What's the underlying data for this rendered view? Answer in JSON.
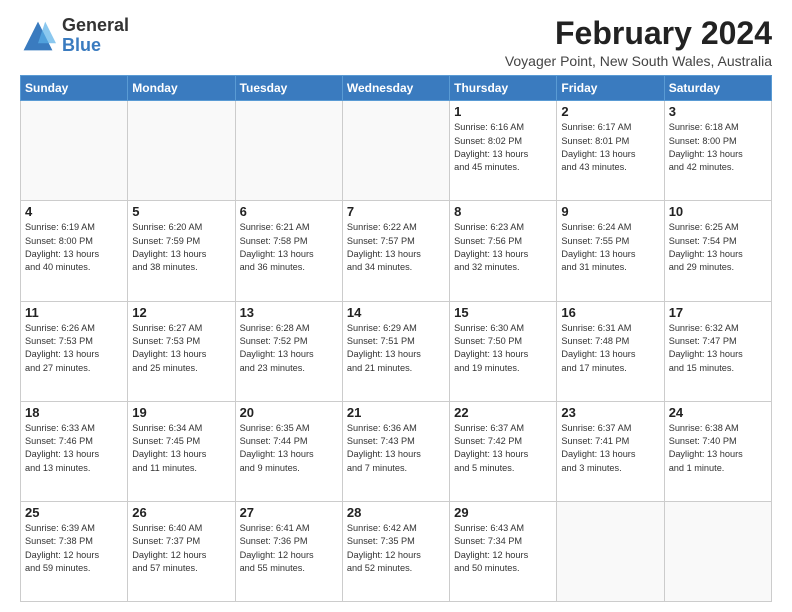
{
  "logo": {
    "general": "General",
    "blue": "Blue"
  },
  "title": "February 2024",
  "subtitle": "Voyager Point, New South Wales, Australia",
  "days_header": [
    "Sunday",
    "Monday",
    "Tuesday",
    "Wednesday",
    "Thursday",
    "Friday",
    "Saturday"
  ],
  "weeks": [
    [
      {
        "day": "",
        "info": ""
      },
      {
        "day": "",
        "info": ""
      },
      {
        "day": "",
        "info": ""
      },
      {
        "day": "",
        "info": ""
      },
      {
        "day": "1",
        "info": "Sunrise: 6:16 AM\nSunset: 8:02 PM\nDaylight: 13 hours\nand 45 minutes."
      },
      {
        "day": "2",
        "info": "Sunrise: 6:17 AM\nSunset: 8:01 PM\nDaylight: 13 hours\nand 43 minutes."
      },
      {
        "day": "3",
        "info": "Sunrise: 6:18 AM\nSunset: 8:00 PM\nDaylight: 13 hours\nand 42 minutes."
      }
    ],
    [
      {
        "day": "4",
        "info": "Sunrise: 6:19 AM\nSunset: 8:00 PM\nDaylight: 13 hours\nand 40 minutes."
      },
      {
        "day": "5",
        "info": "Sunrise: 6:20 AM\nSunset: 7:59 PM\nDaylight: 13 hours\nand 38 minutes."
      },
      {
        "day": "6",
        "info": "Sunrise: 6:21 AM\nSunset: 7:58 PM\nDaylight: 13 hours\nand 36 minutes."
      },
      {
        "day": "7",
        "info": "Sunrise: 6:22 AM\nSunset: 7:57 PM\nDaylight: 13 hours\nand 34 minutes."
      },
      {
        "day": "8",
        "info": "Sunrise: 6:23 AM\nSunset: 7:56 PM\nDaylight: 13 hours\nand 32 minutes."
      },
      {
        "day": "9",
        "info": "Sunrise: 6:24 AM\nSunset: 7:55 PM\nDaylight: 13 hours\nand 31 minutes."
      },
      {
        "day": "10",
        "info": "Sunrise: 6:25 AM\nSunset: 7:54 PM\nDaylight: 13 hours\nand 29 minutes."
      }
    ],
    [
      {
        "day": "11",
        "info": "Sunrise: 6:26 AM\nSunset: 7:53 PM\nDaylight: 13 hours\nand 27 minutes."
      },
      {
        "day": "12",
        "info": "Sunrise: 6:27 AM\nSunset: 7:53 PM\nDaylight: 13 hours\nand 25 minutes."
      },
      {
        "day": "13",
        "info": "Sunrise: 6:28 AM\nSunset: 7:52 PM\nDaylight: 13 hours\nand 23 minutes."
      },
      {
        "day": "14",
        "info": "Sunrise: 6:29 AM\nSunset: 7:51 PM\nDaylight: 13 hours\nand 21 minutes."
      },
      {
        "day": "15",
        "info": "Sunrise: 6:30 AM\nSunset: 7:50 PM\nDaylight: 13 hours\nand 19 minutes."
      },
      {
        "day": "16",
        "info": "Sunrise: 6:31 AM\nSunset: 7:48 PM\nDaylight: 13 hours\nand 17 minutes."
      },
      {
        "day": "17",
        "info": "Sunrise: 6:32 AM\nSunset: 7:47 PM\nDaylight: 13 hours\nand 15 minutes."
      }
    ],
    [
      {
        "day": "18",
        "info": "Sunrise: 6:33 AM\nSunset: 7:46 PM\nDaylight: 13 hours\nand 13 minutes."
      },
      {
        "day": "19",
        "info": "Sunrise: 6:34 AM\nSunset: 7:45 PM\nDaylight: 13 hours\nand 11 minutes."
      },
      {
        "day": "20",
        "info": "Sunrise: 6:35 AM\nSunset: 7:44 PM\nDaylight: 13 hours\nand 9 minutes."
      },
      {
        "day": "21",
        "info": "Sunrise: 6:36 AM\nSunset: 7:43 PM\nDaylight: 13 hours\nand 7 minutes."
      },
      {
        "day": "22",
        "info": "Sunrise: 6:37 AM\nSunset: 7:42 PM\nDaylight: 13 hours\nand 5 minutes."
      },
      {
        "day": "23",
        "info": "Sunrise: 6:37 AM\nSunset: 7:41 PM\nDaylight: 13 hours\nand 3 minutes."
      },
      {
        "day": "24",
        "info": "Sunrise: 6:38 AM\nSunset: 7:40 PM\nDaylight: 13 hours\nand 1 minute."
      }
    ],
    [
      {
        "day": "25",
        "info": "Sunrise: 6:39 AM\nSunset: 7:38 PM\nDaylight: 12 hours\nand 59 minutes."
      },
      {
        "day": "26",
        "info": "Sunrise: 6:40 AM\nSunset: 7:37 PM\nDaylight: 12 hours\nand 57 minutes."
      },
      {
        "day": "27",
        "info": "Sunrise: 6:41 AM\nSunset: 7:36 PM\nDaylight: 12 hours\nand 55 minutes."
      },
      {
        "day": "28",
        "info": "Sunrise: 6:42 AM\nSunset: 7:35 PM\nDaylight: 12 hours\nand 52 minutes."
      },
      {
        "day": "29",
        "info": "Sunrise: 6:43 AM\nSunset: 7:34 PM\nDaylight: 12 hours\nand 50 minutes."
      },
      {
        "day": "",
        "info": ""
      },
      {
        "day": "",
        "info": ""
      }
    ]
  ]
}
